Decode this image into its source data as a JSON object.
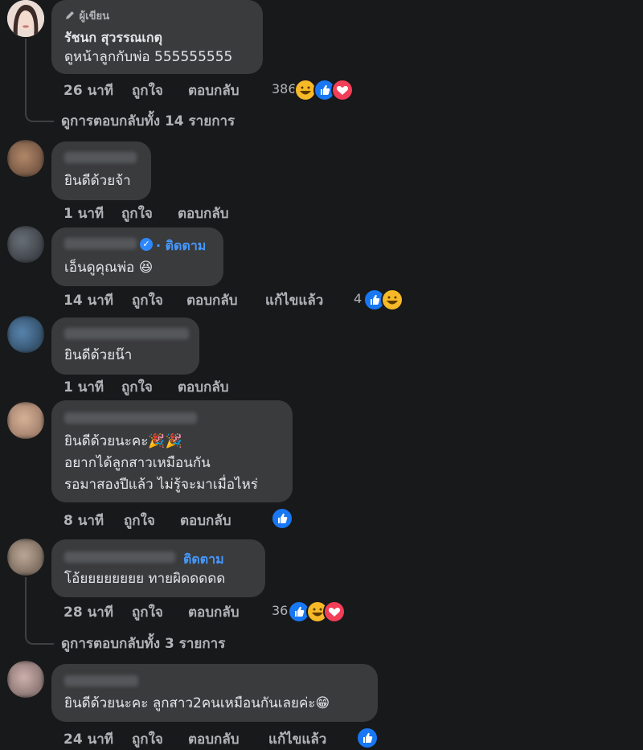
{
  "comments": [
    {
      "author_tag": "ผู้เขียน",
      "name": "รัชนก สุวรรณเกตุ",
      "text": [
        "ดูหน้าลูกกับพ่อ 555555555"
      ],
      "time": "26 นาที",
      "like": "ถูกใจ",
      "reply": "ตอบกลับ",
      "reaction_count": "386",
      "reactions": [
        "haha-icon",
        "like-icon",
        "love-icon"
      ],
      "view_replies": "ดูการตอบกลับทั้ง 14 รายการ"
    },
    {
      "text": [
        "ยินดีด้วยจ้า"
      ],
      "time": "1 นาที",
      "like": "ถูกใจ",
      "reply": "ตอบกลับ"
    },
    {
      "follow": "· ติดตาม",
      "text": [
        "เอ็นดูคุณพ่อ 😆"
      ],
      "time": "14 นาที",
      "like": "ถูกใจ",
      "reply": "ตอบกลับ",
      "edited": "แก้ไขแล้ว",
      "reaction_count": "4",
      "reactions": [
        "like-icon",
        "haha-icon"
      ]
    },
    {
      "text": [
        "ยินดีด้วยน๊า"
      ],
      "time": "1 นาที",
      "like": "ถูกใจ",
      "reply": "ตอบกลับ"
    },
    {
      "text": [
        "ยินดีด้วยนะคะ🎉🎉",
        "อยากได้ลูกสาวเหมือนกัน",
        "รอมาสองปีแล้ว ไม่รู้จะมาเมื่อไหร่"
      ],
      "time": "8 นาที",
      "like": "ถูกใจ",
      "reply": "ตอบกลับ",
      "reactions": [
        "like-icon"
      ]
    },
    {
      "follow": "ติดตาม",
      "text": [
        "โอ้ยยยยยยยย ทายผิดดดดด"
      ],
      "time": "28 นาที",
      "like": "ถูกใจ",
      "reply": "ตอบกลับ",
      "reaction_count": "36",
      "reactions": [
        "like-icon",
        "haha-icon",
        "love-icon"
      ],
      "view_replies": "ดูการตอบกลับทั้ง 3 รายการ"
    },
    {
      "text": [
        "ยินดีด้วยนะคะ ลูกสาว2คนเหมือนกันเลยค่ะ😁"
      ],
      "time": "24 นาที",
      "like": "ถูกใจ",
      "reply": "ตอบกลับ",
      "edited": "แก้ไขแล้ว",
      "reactions": [
        "like-icon"
      ]
    }
  ],
  "colors": {
    "background": "#18191a",
    "bubble": "#3a3b3c",
    "text": "#e4e6eb",
    "secondary": "#b0b3b8",
    "link": "#4599ff",
    "like": "#1877f2",
    "love": "#f33e58",
    "haha": "#f7b928"
  }
}
